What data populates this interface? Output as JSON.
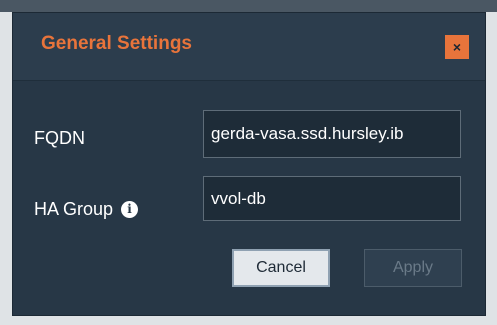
{
  "dialog": {
    "title": "General Settings",
    "close_glyph": "×",
    "close_icon": "close-icon",
    "accent_color": "#e8743b",
    "background_color": "#273746"
  },
  "fields": {
    "fqdn": {
      "label": "FQDN",
      "value": "gerda-vasa.ssd.hursley.ib"
    },
    "ha_group": {
      "label": "HA Group",
      "info_glyph": "i",
      "info_icon": "info-icon",
      "value": "vvol-db"
    }
  },
  "actions": {
    "cancel_label": "Cancel",
    "apply_label": "Apply",
    "apply_enabled": false
  }
}
